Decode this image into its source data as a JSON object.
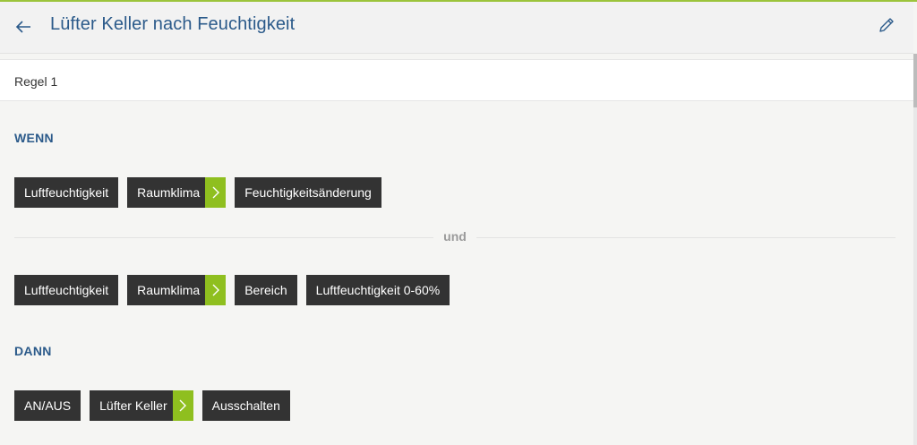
{
  "header": {
    "title": "Lüfter Keller nach Feuchtigkeit",
    "back_icon": "arrow-left-icon",
    "edit_icon": "pencil-icon"
  },
  "rule": {
    "label": "Regel 1"
  },
  "if_section": {
    "label": "WENN",
    "condition1": {
      "chip1": "Luftfeuchtigkeit",
      "chip2": "Raumklima",
      "chip3": "Feuchtigkeitsänderung"
    },
    "connector": "und",
    "condition2": {
      "chip1": "Luftfeuchtigkeit",
      "chip2": "Raumklima",
      "chip3": "Bereich",
      "chip4": "Luftfeuchtigkeit 0-60%"
    }
  },
  "then_section": {
    "label": "DANN",
    "action": {
      "chip1": "AN/AUS",
      "chip2": "Lüfter Keller",
      "chip3": "Ausschalten"
    }
  },
  "colors": {
    "accent": "#2b5a8a",
    "chip_bg": "#333333",
    "chip_arrow": "#8fbf1f",
    "top_line": "#9cc43c"
  }
}
